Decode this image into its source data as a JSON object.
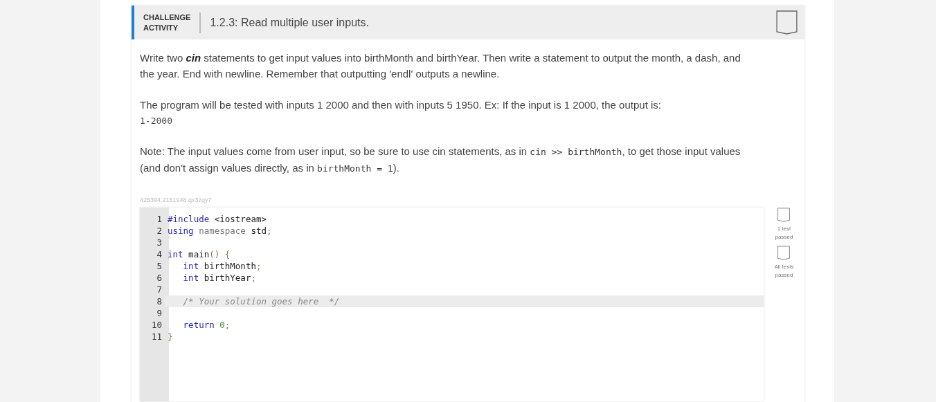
{
  "header": {
    "label_line_1": "CHALLENGE",
    "label_line_2": "ACTIVITY",
    "title": "1.2.3: Read multiple user inputs.",
    "completed": false
  },
  "instructions": [
    [
      {
        "kind": "text",
        "text": "Write two "
      },
      {
        "kind": "strong",
        "text": "cin"
      },
      {
        "kind": "text",
        "text": " statements to get input values into birthMonth and birthYear. Then write a statement to output the month, a dash, and the year. End with newline. Remember that outputting 'endl' outputs a newline."
      }
    ],
    [
      {
        "kind": "text",
        "text": "The program will be tested with inputs 1 2000 and then with inputs 5 1950. Ex: If the input is 1 2000, the output is:"
      }
    ],
    [
      {
        "kind": "output",
        "text": "1-2000"
      }
    ],
    [
      {
        "kind": "text",
        "text": "Note: The input values come from user input, so be sure to use cin statements, as in "
      },
      {
        "kind": "code",
        "text": "cin >> birthMonth"
      },
      {
        "kind": "text",
        "text": ", to get those input values (and don't assign values directly, as in "
      },
      {
        "kind": "code",
        "text": "birthMonth = 1"
      },
      {
        "kind": "text",
        "text": ")."
      }
    ]
  ],
  "activity_id": "425394.2151948.qx3zqy7",
  "code_lines": [
    {
      "number": "1",
      "active": false,
      "tokens": [
        {
          "kind": "keyword",
          "text": "#include"
        },
        {
          "kind": "plain",
          "text": " <iostream>"
        }
      ]
    },
    {
      "number": "2",
      "active": false,
      "tokens": [
        {
          "kind": "keyword",
          "text": "using"
        },
        {
          "kind": "muted",
          "text": " namespace"
        },
        {
          "kind": "plain",
          "text": " std"
        },
        {
          "kind": "punct",
          "text": ";"
        }
      ]
    },
    {
      "number": "3",
      "active": false
    },
    {
      "number": "4",
      "active": false,
      "tokens": [
        {
          "kind": "keyword",
          "text": "int"
        },
        {
          "kind": "plain",
          "text": " main"
        },
        {
          "kind": "punct",
          "text": "() {"
        }
      ]
    },
    {
      "number": "5",
      "active": false,
      "tokens": [
        {
          "kind": "keyword",
          "text": "   int"
        },
        {
          "kind": "plain",
          "text": " birthMonth"
        },
        {
          "kind": "punct",
          "text": ";"
        }
      ]
    },
    {
      "number": "6",
      "active": false,
      "tokens": [
        {
          "kind": "keyword",
          "text": "   int"
        },
        {
          "kind": "plain",
          "text": " birthYear"
        },
        {
          "kind": "punct",
          "text": ";"
        }
      ]
    },
    {
      "number": "7",
      "active": false
    },
    {
      "number": "8",
      "active": true,
      "tokens": [
        {
          "kind": "comment",
          "text": "   /* Your solution goes here  */"
        }
      ]
    },
    {
      "number": "9",
      "active": false
    },
    {
      "number": "10",
      "active": false,
      "tokens": [
        {
          "kind": "keyword",
          "text": "   return"
        },
        {
          "kind": "number",
          "text": " 0"
        },
        {
          "kind": "punct",
          "text": ";"
        }
      ]
    },
    {
      "number": "11",
      "active": false,
      "tokens": [
        {
          "kind": "punct",
          "text": "}"
        }
      ]
    }
  ],
  "tests": [
    {
      "label_line_1": "1 test",
      "label_line_2": "passed",
      "passed": false
    },
    {
      "label_line_1": "All tests",
      "label_line_2": "passed",
      "passed": false
    }
  ]
}
